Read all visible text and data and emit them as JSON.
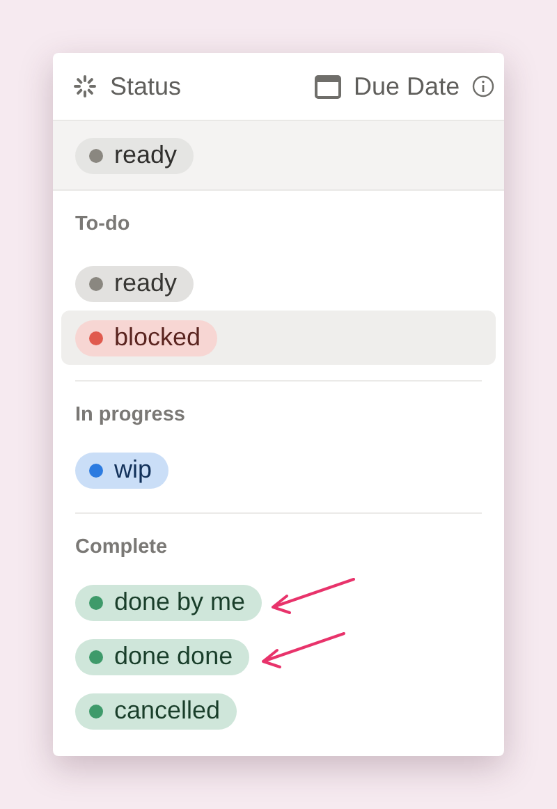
{
  "header": {
    "columns": [
      {
        "kind": "status",
        "label": "Status"
      },
      {
        "kind": "date",
        "label": "Due Date"
      }
    ]
  },
  "current": {
    "label": "ready",
    "color": "#8a8780"
  },
  "groups": [
    {
      "title": "To-do",
      "options": [
        {
          "label": "ready",
          "color": "#8a8780",
          "selected": false,
          "arrow": false
        },
        {
          "label": "blocked",
          "color": "#e05a4e",
          "selected": true,
          "arrow": false
        }
      ]
    },
    {
      "title": "In progress",
      "options": [
        {
          "label": "wip",
          "color": "#2c7be0",
          "selected": false,
          "arrow": false
        }
      ]
    },
    {
      "title": "Complete",
      "options": [
        {
          "label": "done by me",
          "color": "#3e9a6a",
          "selected": false,
          "arrow": true
        },
        {
          "label": "done done",
          "color": "#3e9a6a",
          "selected": false,
          "arrow": true
        },
        {
          "label": "cancelled",
          "color": "#3e9a6a",
          "selected": false,
          "arrow": false
        }
      ]
    }
  ]
}
